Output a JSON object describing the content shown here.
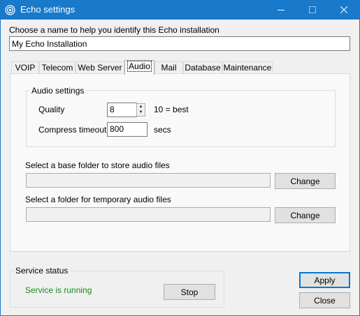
{
  "window": {
    "title": "Echo settings",
    "icon": "echo-logo-icon",
    "controls": [
      "minimize-icon",
      "maximize-icon",
      "close-icon"
    ]
  },
  "installation": {
    "prompt": "Choose a name to help you identify this Echo installation",
    "name_value": "My Echo Installation"
  },
  "tabs": [
    {
      "label": "VOIP"
    },
    {
      "label": "Telecom"
    },
    {
      "label": "Web Server"
    },
    {
      "label": "Audio",
      "active": true
    },
    {
      "label": "Mail"
    },
    {
      "label": "Database"
    },
    {
      "label": "Maintenance"
    }
  ],
  "audio": {
    "group_title": "Audio settings",
    "quality_label": "Quality",
    "quality_value": "8",
    "quality_hint": "10 = best",
    "compress_label": "Compress timeout",
    "compress_value": "800",
    "compress_unit": "secs",
    "base_folder_label": "Select a base folder to store audio files",
    "base_folder_value": "",
    "temp_folder_label": "Select a folder for temporary audio files",
    "temp_folder_value": "",
    "change_label": "Change"
  },
  "service": {
    "group_title": "Service status",
    "status_text": "Service is running",
    "status_color": "#1a8a1a",
    "stop_label": "Stop"
  },
  "footer": {
    "apply_label": "Apply",
    "close_label": "Close"
  },
  "colors": {
    "titlebar": "#1979ca",
    "accent": "#0078d7"
  }
}
